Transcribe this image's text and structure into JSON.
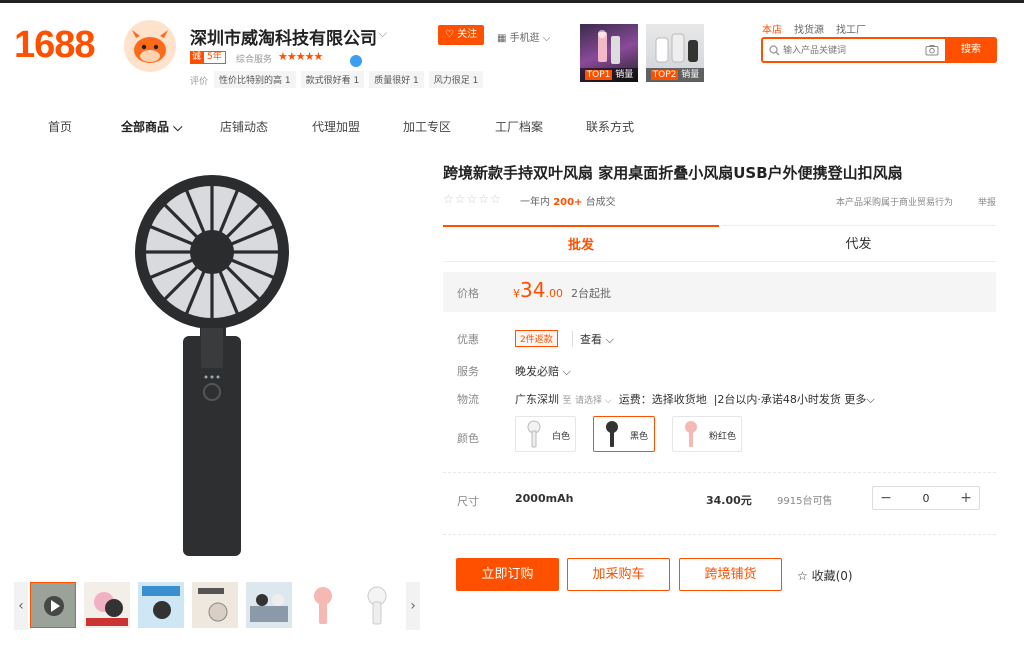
{
  "logo": "1688",
  "shop": {
    "name": "深圳市威淘科技有限公司",
    "years_badge_prefix": "诚",
    "years_badge": "5年",
    "service_label": "综合服务",
    "rating_stars": "★★★★★",
    "eval_label": "评价",
    "eval_tags": [
      "性价比特别的高 1",
      "款式很好看 1",
      "质量很好 1",
      "风力很足 1"
    ]
  },
  "header": {
    "follow": "关注",
    "mobile": "手机逛",
    "top_products": [
      {
        "rank": "TOP1",
        "label": "销量"
      },
      {
        "rank": "TOP2",
        "label": "销量"
      }
    ],
    "search_tabs": [
      "本店",
      "找货源",
      "找工厂"
    ],
    "search_placeholder": "输入产品关键词",
    "search_button": "搜索"
  },
  "nav": [
    "首页",
    "全部商品",
    "店铺动态",
    "代理加盟",
    "加工专区",
    "工厂档案",
    "联系方式"
  ],
  "product": {
    "title": "跨境新款手持双叶风扇 家用桌面折叠小风扇USB户外便携登山扣风扇",
    "sales_prefix": "一年内",
    "sales_count": "200+",
    "sales_suffix": "台成交",
    "biz_note": "本产品采购属于商业贸易行为",
    "report": "举报",
    "tabs": [
      "批发",
      "代发"
    ],
    "price_label": "价格",
    "currency": "¥",
    "price_int": "34",
    "price_dec": ".00",
    "moq": "2台起批",
    "promo_label": "优惠",
    "promo_tag": "2件返款",
    "promo_view": "查看",
    "service_label": "服务",
    "service_value": "晚发必赔",
    "logistics_label": "物流",
    "logistics_from": "广东深圳",
    "logistics_to": "至",
    "logistics_select": "请选择",
    "logistics_fee": "运费：选择收货地",
    "logistics_ship": "2台以内·承诺48小时发货",
    "logistics_more": "更多",
    "color_label": "颜色",
    "colors": [
      {
        "name": "白色",
        "selected": false,
        "swatch": "#f2f2f2"
      },
      {
        "name": "黑色",
        "selected": true,
        "swatch": "#333333"
      },
      {
        "name": "粉红色",
        "selected": false,
        "swatch": "#f4b9b2"
      }
    ],
    "size_label": "尺寸",
    "sku": {
      "spec": "2000mAh",
      "price": "34.00元",
      "stock": "9915台可售",
      "quantity": "0"
    },
    "buttons": {
      "buy": "立即订购",
      "cart": "加采购车",
      "cross": "跨境铺货"
    },
    "favorite": "收藏(0)"
  },
  "accent": "#ff5000"
}
